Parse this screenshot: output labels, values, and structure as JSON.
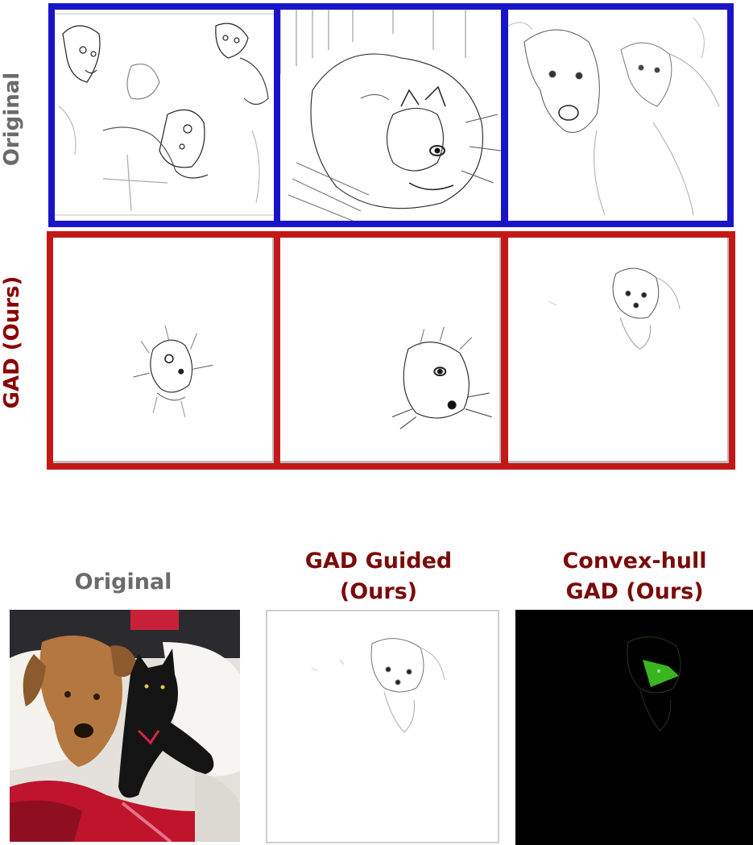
{
  "top_grid": {
    "row_labels": {
      "original": "Original",
      "gad": "GAD (Ours)"
    },
    "colors": {
      "original_label": "#6b6b6b",
      "gad_label": "#8b0000",
      "original_border": "#1a14c8",
      "gad_border": "#c41818"
    }
  },
  "bottom": {
    "titles": {
      "original": "Original",
      "gad_guided": [
        "GAD Guided",
        "(Ours)"
      ],
      "convex_hull": [
        "Convex-hull",
        "GAD (Ours)"
      ]
    },
    "colors": {
      "original_title": "#6b6b6b",
      "ours_title": "#7a0a0a",
      "hull_highlight": "#39b51f"
    }
  }
}
